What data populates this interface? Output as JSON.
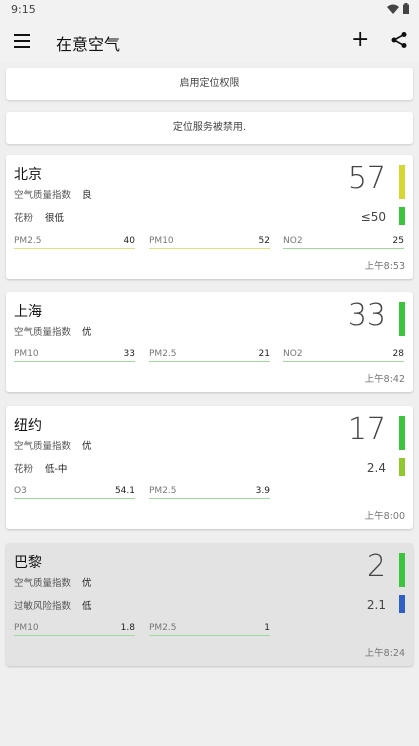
{
  "status": {
    "time": "9:15"
  },
  "app": {
    "title": "在意空气"
  },
  "banners": [
    "启用定位权限",
    "定位服务被禁用."
  ],
  "colors": {
    "green": "#3dc43d",
    "yellow": "#d7d734",
    "lime": "#8fc92e",
    "blue": "#2f5fc4"
  },
  "cards": [
    {
      "city": "北京",
      "aqi_label": "空气质量指数",
      "aqi_rating": "良",
      "aqi": "57",
      "sub_label": "花粉",
      "sub_rating": "很低",
      "sub_value": "≤50",
      "pollutants": [
        {
          "name": "PM2.5",
          "value": "40"
        },
        {
          "name": "PM10",
          "value": "52"
        },
        {
          "name": "NO2",
          "value": "25"
        }
      ],
      "time": "上午8:53"
    },
    {
      "city": "上海",
      "aqi_label": "空气质量指数",
      "aqi_rating": "优",
      "aqi": "33",
      "pollutants": [
        {
          "name": "PM10",
          "value": "33"
        },
        {
          "name": "PM2.5",
          "value": "21"
        },
        {
          "name": "NO2",
          "value": "28"
        }
      ],
      "time": "上午8:42"
    },
    {
      "city": "纽约",
      "aqi_label": "空气质量指数",
      "aqi_rating": "优",
      "aqi": "17",
      "sub_label": "花粉",
      "sub_rating": "低-中",
      "sub_value": "2.4",
      "pollutants": [
        {
          "name": "O3",
          "value": "54.1"
        },
        {
          "name": "PM2.5",
          "value": "3.9"
        }
      ],
      "time": "上午8:00"
    },
    {
      "city": "巴黎",
      "aqi_label": "空气质量指数",
      "aqi_rating": "优",
      "aqi": "2",
      "sub_label": "过敏风险指数",
      "sub_rating": "低",
      "sub_value": "2.1",
      "pollutants": [
        {
          "name": "PM10",
          "value": "1.8"
        },
        {
          "name": "PM2.5",
          "value": "1"
        }
      ],
      "time": "上午8:24"
    }
  ]
}
